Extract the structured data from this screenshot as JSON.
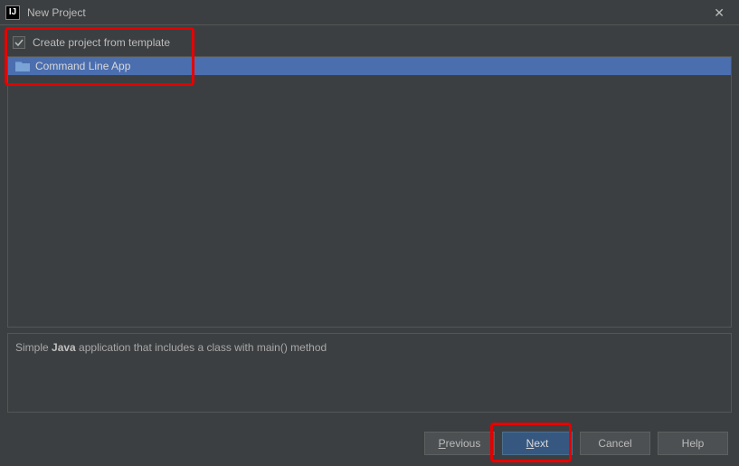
{
  "titlebar": {
    "title": "New Project"
  },
  "checkbox": {
    "label": "Create project from template",
    "checked": true
  },
  "templates": {
    "items": [
      {
        "label": "Command Line App"
      }
    ]
  },
  "description": {
    "prefix": "Simple ",
    "bold": "Java",
    "suffix": " application that includes a class with main() method"
  },
  "buttons": {
    "previous": "Previous",
    "next": "Next",
    "cancel": "Cancel",
    "help": "Help"
  }
}
